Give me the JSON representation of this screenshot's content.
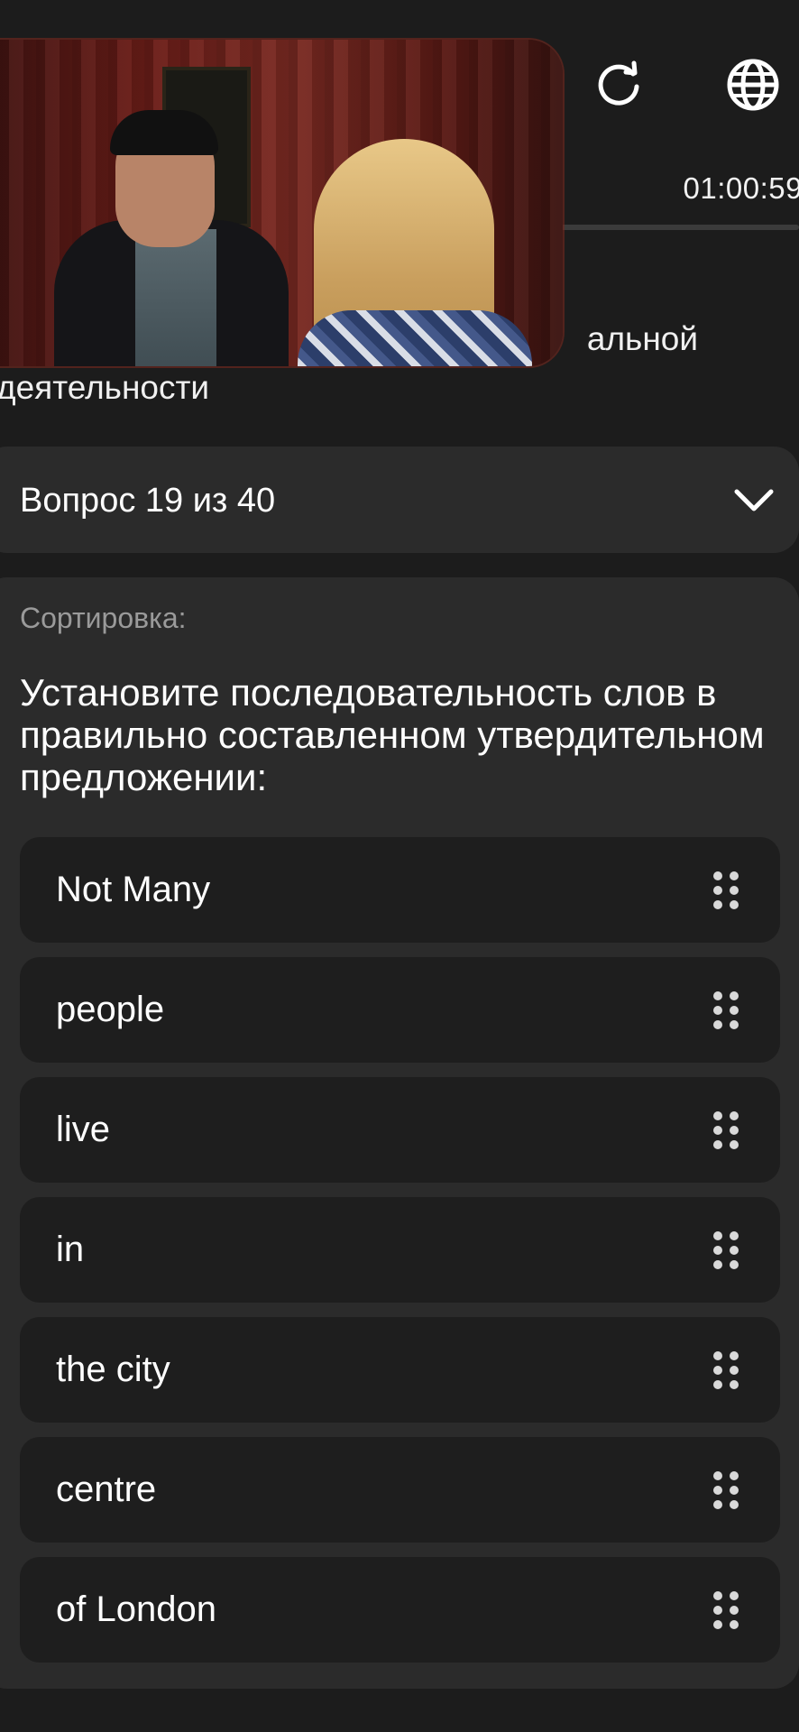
{
  "header": {
    "refresh_icon": "refresh-icon",
    "globe_icon": "globe-icon",
    "timer": "01:00:59"
  },
  "course": {
    "title_visible_tail": "альной",
    "title_line2": "деятельности"
  },
  "question": {
    "label": "Вопрос 19 из 40",
    "chevron_icon": "chevron-down-icon"
  },
  "task": {
    "type_label": "Сортировка:",
    "prompt": "Установите последовательность слов в правильно составленном утвердительном предложении:",
    "items": [
      {
        "label": "Not Many"
      },
      {
        "label": "people"
      },
      {
        "label": "live"
      },
      {
        "label": "in"
      },
      {
        "label": "the city"
      },
      {
        "label": "centre"
      },
      {
        "label": "of London"
      }
    ],
    "drag_icon": "drag-handle-icon"
  },
  "colors": {
    "background": "#1c1c1c",
    "card": "#2b2b2b",
    "item": "#1e1e1e",
    "muted_text": "#9a9a9a"
  }
}
